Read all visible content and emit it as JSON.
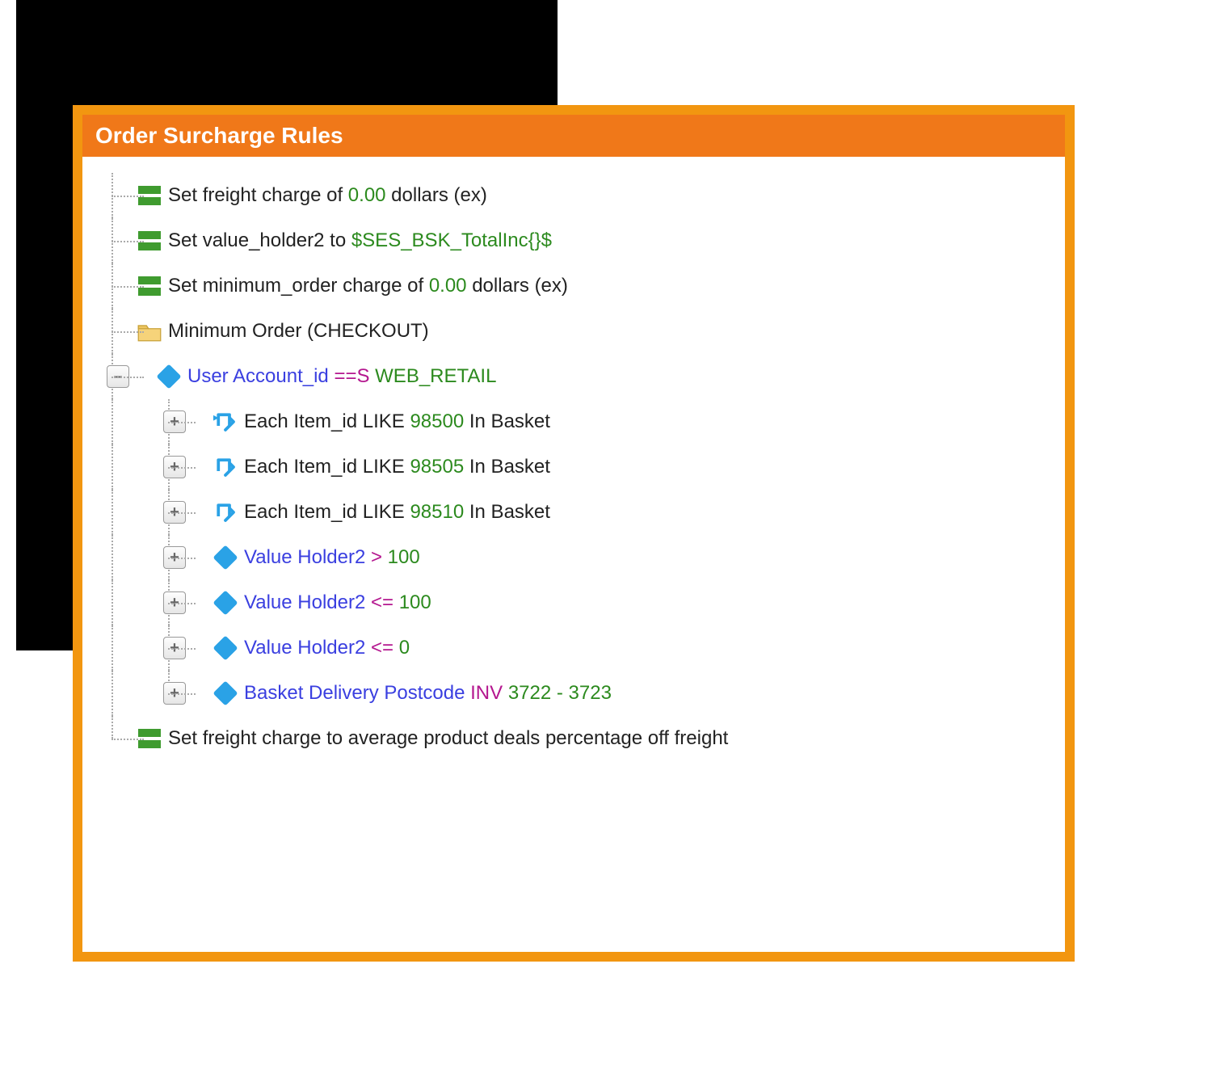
{
  "panel": {
    "title": "Order Surcharge Rules"
  },
  "toggles": {
    "plus": "+",
    "minus": "–"
  },
  "rows": [
    {
      "p1": "Set freight charge of ",
      "g1": "0.00",
      "p2": " dollars (ex)"
    },
    {
      "p1": "Set value_holder2 to ",
      "g1": "$SES_BSK_TotalInc{}$"
    },
    {
      "p1": "Set minimum_order charge of ",
      "g1": "0.00",
      "p2": " dollars (ex)"
    },
    {
      "p1": "Minimum Order (CHECKOUT)"
    },
    {
      "b1": "User Account_id ",
      "m1": "==S ",
      "g1": "WEB_RETAIL"
    },
    {
      "p1": "Each Item_id LIKE ",
      "g1": "98500",
      "p2": " In Basket"
    },
    {
      "p1": "Each Item_id LIKE ",
      "g1": "98505",
      "p2": " In Basket"
    },
    {
      "p1": "Each Item_id LIKE ",
      "g1": "98510",
      "p2": " In Basket"
    },
    {
      "b1": "Value Holder2 ",
      "m1": "> ",
      "g1": "100"
    },
    {
      "b1": "Value Holder2 ",
      "m1": "<= ",
      "g1": "100"
    },
    {
      "b1": "Value Holder2 ",
      "m1": "<= ",
      "g1": "0"
    },
    {
      "b1": "Basket Delivery Postcode ",
      "m1": "INV ",
      "g1": "3722 - 3723"
    },
    {
      "p1": "Set freight charge to average product deals percentage off freight"
    }
  ]
}
